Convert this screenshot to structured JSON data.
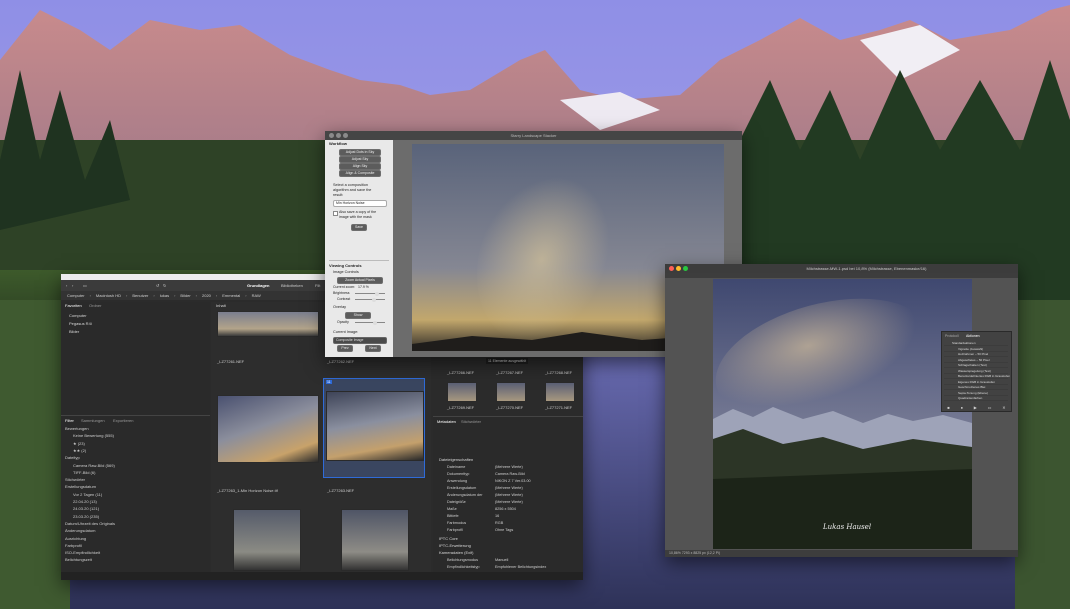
{
  "finder": {
    "tabs": [
      "Grundlagen",
      "Bibliotheken",
      "Filt"
    ],
    "breadcrumb": [
      "Computer",
      "Macintosh HD",
      "Benutzer",
      "lukas",
      "Bilder",
      "2020",
      "Emmental",
      "RAW"
    ],
    "favorites_header": [
      "Favoriten",
      "Ordner"
    ],
    "favorites": [
      "Computer",
      "Pegasus R4i",
      "Bilder"
    ],
    "content_header": "Inhalt",
    "filter_tabs": [
      "Filter",
      "Sammlungen",
      "Exportieren"
    ],
    "filter_rows": [
      "Bewertungen",
      "Keine Bewertung (555)",
      "★ (23)",
      "★★ (2)",
      "Dateityp",
      "Camera Raw-Bild (569)",
      "TIFF-Bild (6)",
      "Stichwörter",
      "Erstellungsdatum",
      "Vor 2 Tagen (11)",
      "22.04.20 (13)",
      "24.03.20 (121)",
      "23.03.20 (235)",
      "Datum/Uhrzeit des Originals",
      "Änderungsdatum",
      "Ausrichtung",
      "Farbprofil",
      "ISO-Empfindlichkeit",
      "Belichtungszeit"
    ],
    "files": [
      "_LZ77261.NEF",
      "_LZ77262.NEF",
      "_LZ77263_1-Min Horizon Noise.tif",
      "_LZ77263.NEF"
    ],
    "selected_badge": "11",
    "right_files": [
      "_LZ77266.NEF",
      "_LZ77267.NEF",
      "_LZ77268.NEF",
      "_LZ77269.NEF",
      "_LZ77270.NEF",
      "_LZ77271.NEF"
    ],
    "selection_status": "11 Elemente ausgewählt",
    "meta_tabs": [
      "Metadaten",
      "Stichwörter"
    ],
    "meta_section": "Dateieigenschaften",
    "meta_rows": [
      [
        "Dateiname",
        "(Mehrere Werte)"
      ],
      [
        "Dokumenttyp",
        "Camera Raw-Bild"
      ],
      [
        "Anwendung",
        "NIKON Z 7 Ver.03.00"
      ],
      [
        "Erstellungsdatum",
        "(Mehrere Werte)"
      ],
      [
        "Änderungsdatum der",
        "(Mehrere Werte)"
      ],
      [
        "Dateigröße",
        "(Mehrere Werte)"
      ],
      [
        "Maße",
        "8256 x 5504"
      ],
      [
        "Bittiefe",
        "16"
      ],
      [
        "Farbmodus",
        "RGB"
      ],
      [
        "Farbprofil",
        "Ohne Tags"
      ]
    ],
    "meta_sections": [
      "IPTC Core",
      "IPTC-Erweiterung",
      "Kameradaten (Exif)"
    ],
    "exif_rows": [
      [
        "Belichtungsmodus",
        "Manuell"
      ],
      [
        "Empfindlichkeitstyp",
        "Empfohlener Belichtungsindex"
      ]
    ]
  },
  "starry": {
    "title": "Starry Landscape Stacker",
    "workflow_header": "Workflow",
    "workflow_buttons": [
      "Adjust Dots in Sky",
      "Adjust Sky",
      "Align Sky",
      "Align & Composite"
    ],
    "description": [
      "Select a composition",
      "algorithm and save the",
      "result:"
    ],
    "algorithm": "Min Horizon Noise",
    "checkbox_label": [
      "Also save a copy of the",
      "image with the mask"
    ],
    "save_button": "Save",
    "viewing_header": "Viewing Controls",
    "image_controls": "Image Controls",
    "zoom_button": "Zoom Actual Pixels",
    "current_zoom_label": "Current zoom:",
    "current_zoom_value": "17.9 %",
    "brightness_label": "Brightness",
    "contrast_label": "Contrast",
    "overlay_label": "Overlay",
    "show_button": "Show",
    "opacity_label": "Opacity",
    "current_image_label": "Current Image:",
    "current_image": "Composite Image",
    "prev_button": "Prev",
    "next_button": "Next",
    "brightness": 0.65,
    "contrast": 0.55,
    "opacity": 0.6
  },
  "photoshop": {
    "title": "Milchstrasse-MW-1.psd bei 10,8% (Milchstrasse, Ebenenmaske/16)",
    "status": "10,86%    7293 x 8825 px (12,2 Pi)",
    "panel_tabs": [
      "Protokoll",
      "Aktionen"
    ],
    "actions": [
      "Standardaktionen",
      "Vignette (Auswahl)",
      "Holzrahmen – 50 Pixel",
      "Abgesoftetes – 50 Pixel",
      "Schlagschatten (Text)",
      "Wasserspiegelung (Text)",
      "Benutzerdefiniertes RGB in Graustufen",
      "Eigenes RGB in Graustufen",
      "Geschmolzenes Blei",
      "Sepia-Tonung (Ebene)",
      "Quadrantenfarben"
    ],
    "signature": "Lukas Hausel"
  },
  "colors": {
    "panel": "#323232",
    "panel_dark": "#262626",
    "starry_panel": "#e9e9e9",
    "selection_blue": "#2f6bd8"
  }
}
